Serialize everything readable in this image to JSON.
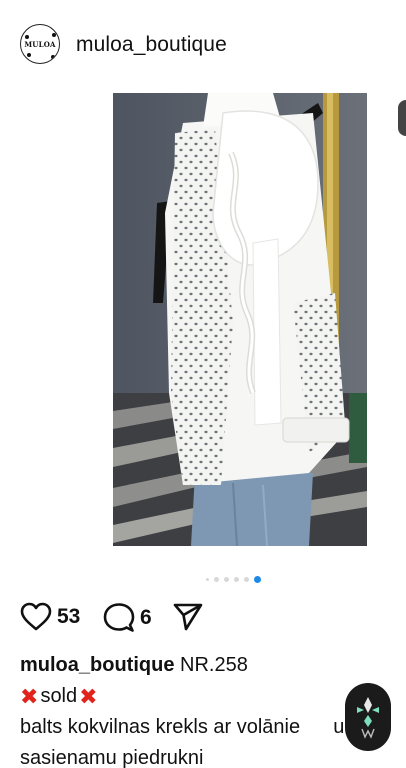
{
  "header": {
    "avatar_text": "MULOA",
    "username": "muloa_boutique"
  },
  "post": {
    "carousel": {
      "total": 6,
      "active_index": 5
    },
    "likes": "53",
    "comments": "6"
  },
  "caption": {
    "username": "muloa_boutique",
    "title": "NR.258",
    "sold_text": "sold",
    "line1": "balts kokvilnas krekls ar volānie",
    "line1_tail": "un",
    "line2": "sasienamu piedrukni"
  },
  "colors": {
    "accent": "#1e88e5",
    "sold_mark": "#e0241b"
  }
}
